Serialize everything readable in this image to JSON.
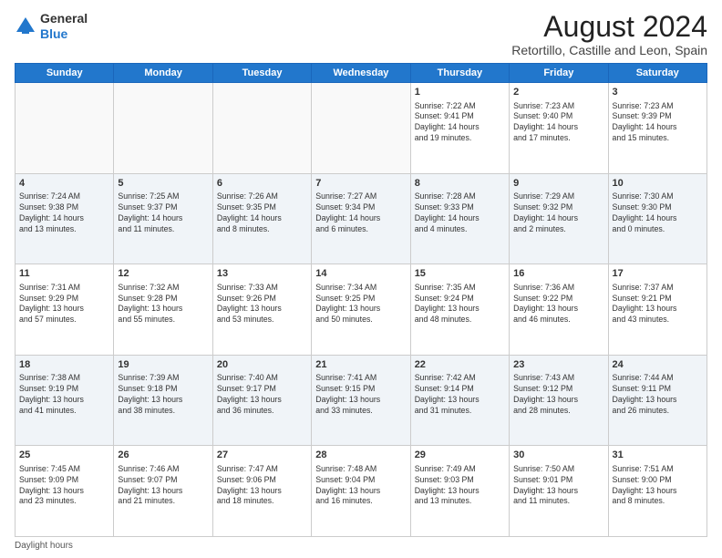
{
  "logo": {
    "general": "General",
    "blue": "Blue"
  },
  "header": {
    "title": "August 2024",
    "subtitle": "Retortillo, Castille and Leon, Spain"
  },
  "days_of_week": [
    "Sunday",
    "Monday",
    "Tuesday",
    "Wednesday",
    "Thursday",
    "Friday",
    "Saturday"
  ],
  "footer": {
    "daylight_label": "Daylight hours"
  },
  "weeks": [
    {
      "cells": [
        {
          "day": "",
          "info": ""
        },
        {
          "day": "",
          "info": ""
        },
        {
          "day": "",
          "info": ""
        },
        {
          "day": "",
          "info": ""
        },
        {
          "day": "1",
          "info": "Sunrise: 7:22 AM\nSunset: 9:41 PM\nDaylight: 14 hours\nand 19 minutes."
        },
        {
          "day": "2",
          "info": "Sunrise: 7:23 AM\nSunset: 9:40 PM\nDaylight: 14 hours\nand 17 minutes."
        },
        {
          "day": "3",
          "info": "Sunrise: 7:23 AM\nSunset: 9:39 PM\nDaylight: 14 hours\nand 15 minutes."
        }
      ]
    },
    {
      "cells": [
        {
          "day": "4",
          "info": "Sunrise: 7:24 AM\nSunset: 9:38 PM\nDaylight: 14 hours\nand 13 minutes."
        },
        {
          "day": "5",
          "info": "Sunrise: 7:25 AM\nSunset: 9:37 PM\nDaylight: 14 hours\nand 11 minutes."
        },
        {
          "day": "6",
          "info": "Sunrise: 7:26 AM\nSunset: 9:35 PM\nDaylight: 14 hours\nand 8 minutes."
        },
        {
          "day": "7",
          "info": "Sunrise: 7:27 AM\nSunset: 9:34 PM\nDaylight: 14 hours\nand 6 minutes."
        },
        {
          "day": "8",
          "info": "Sunrise: 7:28 AM\nSunset: 9:33 PM\nDaylight: 14 hours\nand 4 minutes."
        },
        {
          "day": "9",
          "info": "Sunrise: 7:29 AM\nSunset: 9:32 PM\nDaylight: 14 hours\nand 2 minutes."
        },
        {
          "day": "10",
          "info": "Sunrise: 7:30 AM\nSunset: 9:30 PM\nDaylight: 14 hours\nand 0 minutes."
        }
      ]
    },
    {
      "cells": [
        {
          "day": "11",
          "info": "Sunrise: 7:31 AM\nSunset: 9:29 PM\nDaylight: 13 hours\nand 57 minutes."
        },
        {
          "day": "12",
          "info": "Sunrise: 7:32 AM\nSunset: 9:28 PM\nDaylight: 13 hours\nand 55 minutes."
        },
        {
          "day": "13",
          "info": "Sunrise: 7:33 AM\nSunset: 9:26 PM\nDaylight: 13 hours\nand 53 minutes."
        },
        {
          "day": "14",
          "info": "Sunrise: 7:34 AM\nSunset: 9:25 PM\nDaylight: 13 hours\nand 50 minutes."
        },
        {
          "day": "15",
          "info": "Sunrise: 7:35 AM\nSunset: 9:24 PM\nDaylight: 13 hours\nand 48 minutes."
        },
        {
          "day": "16",
          "info": "Sunrise: 7:36 AM\nSunset: 9:22 PM\nDaylight: 13 hours\nand 46 minutes."
        },
        {
          "day": "17",
          "info": "Sunrise: 7:37 AM\nSunset: 9:21 PM\nDaylight: 13 hours\nand 43 minutes."
        }
      ]
    },
    {
      "cells": [
        {
          "day": "18",
          "info": "Sunrise: 7:38 AM\nSunset: 9:19 PM\nDaylight: 13 hours\nand 41 minutes."
        },
        {
          "day": "19",
          "info": "Sunrise: 7:39 AM\nSunset: 9:18 PM\nDaylight: 13 hours\nand 38 minutes."
        },
        {
          "day": "20",
          "info": "Sunrise: 7:40 AM\nSunset: 9:17 PM\nDaylight: 13 hours\nand 36 minutes."
        },
        {
          "day": "21",
          "info": "Sunrise: 7:41 AM\nSunset: 9:15 PM\nDaylight: 13 hours\nand 33 minutes."
        },
        {
          "day": "22",
          "info": "Sunrise: 7:42 AM\nSunset: 9:14 PM\nDaylight: 13 hours\nand 31 minutes."
        },
        {
          "day": "23",
          "info": "Sunrise: 7:43 AM\nSunset: 9:12 PM\nDaylight: 13 hours\nand 28 minutes."
        },
        {
          "day": "24",
          "info": "Sunrise: 7:44 AM\nSunset: 9:11 PM\nDaylight: 13 hours\nand 26 minutes."
        }
      ]
    },
    {
      "cells": [
        {
          "day": "25",
          "info": "Sunrise: 7:45 AM\nSunset: 9:09 PM\nDaylight: 13 hours\nand 23 minutes."
        },
        {
          "day": "26",
          "info": "Sunrise: 7:46 AM\nSunset: 9:07 PM\nDaylight: 13 hours\nand 21 minutes."
        },
        {
          "day": "27",
          "info": "Sunrise: 7:47 AM\nSunset: 9:06 PM\nDaylight: 13 hours\nand 18 minutes."
        },
        {
          "day": "28",
          "info": "Sunrise: 7:48 AM\nSunset: 9:04 PM\nDaylight: 13 hours\nand 16 minutes."
        },
        {
          "day": "29",
          "info": "Sunrise: 7:49 AM\nSunset: 9:03 PM\nDaylight: 13 hours\nand 13 minutes."
        },
        {
          "day": "30",
          "info": "Sunrise: 7:50 AM\nSunset: 9:01 PM\nDaylight: 13 hours\nand 11 minutes."
        },
        {
          "day": "31",
          "info": "Sunrise: 7:51 AM\nSunset: 9:00 PM\nDaylight: 13 hours\nand 8 minutes."
        }
      ]
    }
  ]
}
